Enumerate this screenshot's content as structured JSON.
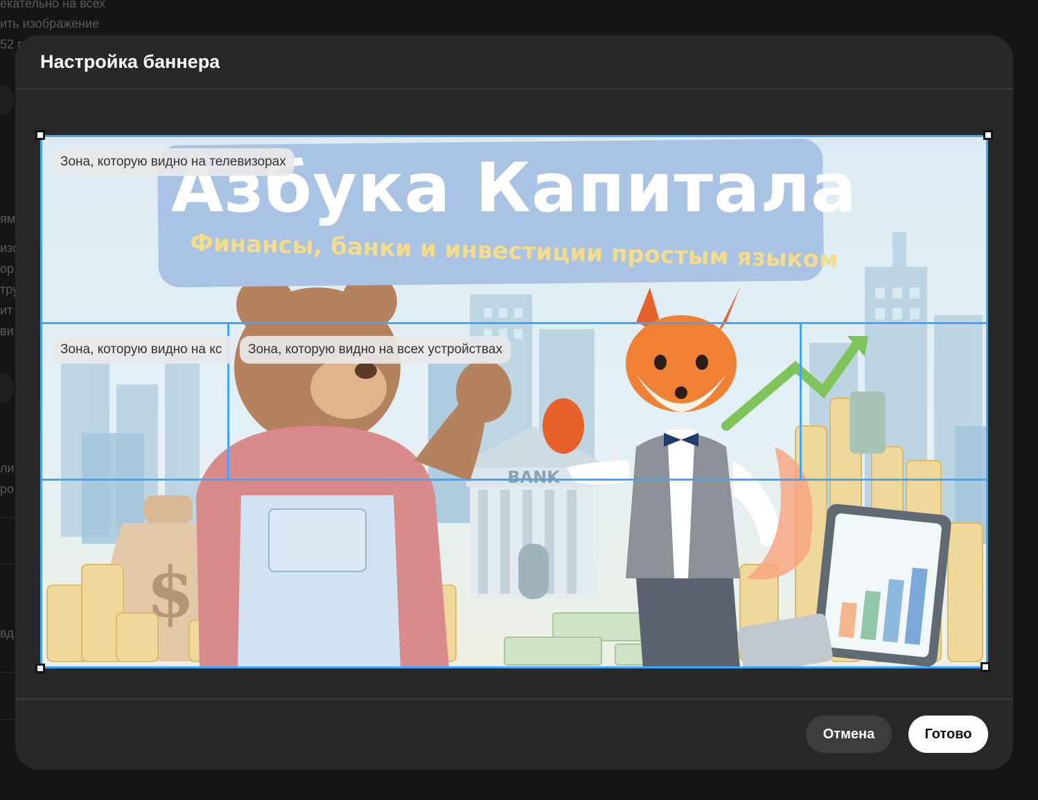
{
  "background_page": {
    "fragments": [
      "екательно на всех",
      "ить изображение",
      "52 г",
      "ям",
      "изо",
      "ор",
      "тру",
      "ит",
      "ви",
      "ли",
      "ро",
      "вд"
    ]
  },
  "dialog": {
    "title": "Настройка баннера",
    "banner": {
      "title": "Азбука Капитала",
      "subtitle": "Финансы, банки и инвестиции простым языком",
      "bank_sign": "BANK",
      "dollar_sign": "$"
    },
    "zones": {
      "tv_label": "Зона, которую видно на телевизорах",
      "desktop_label": "Зона, которую видно на кс",
      "all_devices_label": "Зона, которую видно на всех устройствах"
    },
    "buttons": {
      "cancel": "Отмена",
      "done": "Готово"
    }
  },
  "colors": {
    "accent": "#3ea6ff",
    "dialog_bg": "#282828",
    "page_bg": "#151515"
  }
}
